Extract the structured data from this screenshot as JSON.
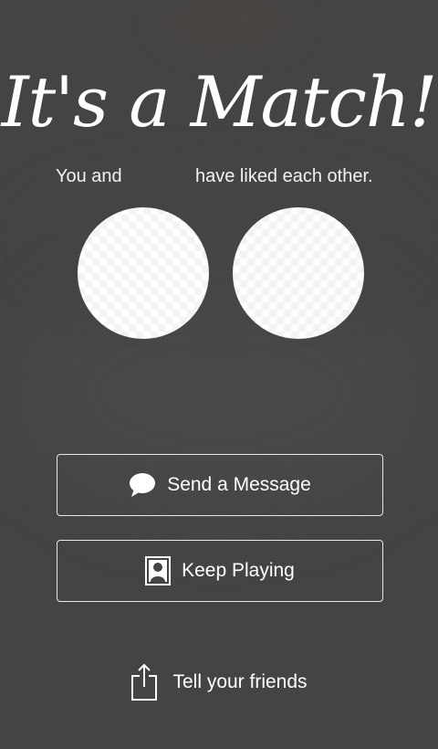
{
  "title": "It's a Match!",
  "liked": {
    "you": "You and",
    "have": "have liked each other."
  },
  "buttons": {
    "send_message": "Send a Message",
    "keep_playing": "Keep Playing"
  },
  "share": {
    "label": "Tell your friends"
  },
  "icons": {
    "message": "speech-bubble-icon",
    "keep_playing": "person-card-icon",
    "share": "share-icon"
  },
  "colors": {
    "background": "#444444",
    "text": "#ffffff",
    "button_border": "#e8e8e8"
  }
}
